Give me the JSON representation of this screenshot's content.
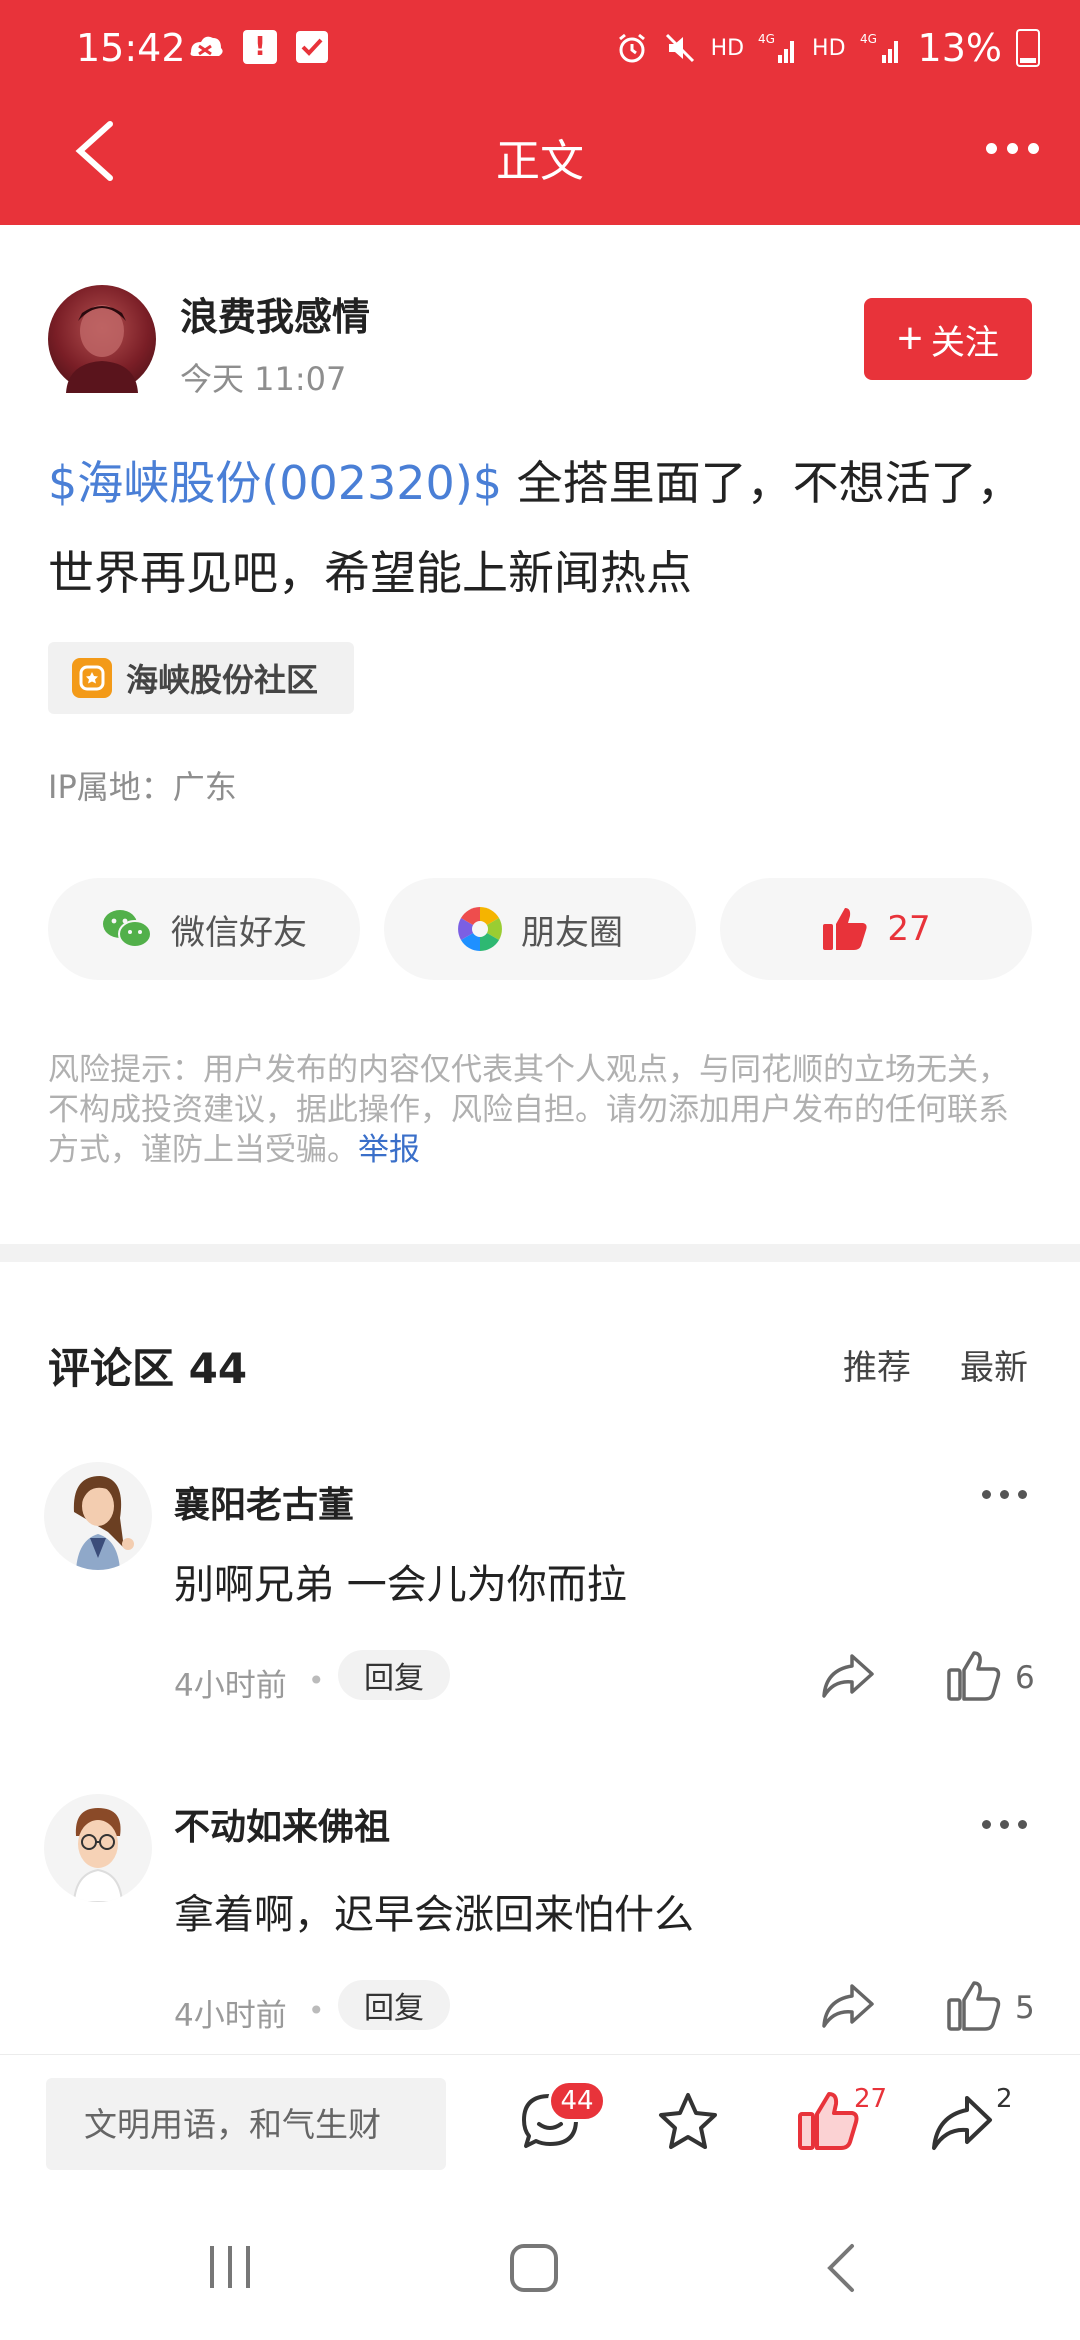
{
  "status_bar": {
    "time": "15:42",
    "right_labels": [
      "HD",
      "4G",
      "HD",
      "4G"
    ],
    "battery": "13%"
  },
  "header": {
    "title": "正文"
  },
  "post": {
    "author": "浪费我感情",
    "time": "今天 11:07",
    "follow_label": "关注",
    "stock_tag": "$海峡股份(002320)$",
    "content": " 全搭里面了，不想活了，世界再见吧，希望能上新闻热点",
    "community": "海峡股份社区",
    "ip_location": "IP属地：广东"
  },
  "share": {
    "wechat_label": "微信好友",
    "moments_label": "朋友圈",
    "like_count": "27"
  },
  "risk_notice": {
    "text": "风险提示：用户发布的内容仅代表其个人观点，与同花顺的立场无关，不构成投资建议，据此操作，风险自担。请勿添加用户发布的任何联系方式，谨防上当受骗。",
    "report_link": "举报"
  },
  "comments": {
    "title": "评论区 44",
    "sort_recommended": "推荐",
    "sort_latest": "最新",
    "items": [
      {
        "user": "襄阳老古董",
        "text": "别啊兄弟 一会儿为你而拉",
        "time": "4小时前",
        "reply_label": "回复",
        "likes": "6"
      },
      {
        "user": "不动如来佛祖",
        "text": "拿着啊，迟早会涨回来怕什么",
        "time": "4小时前",
        "reply_label": "回复",
        "likes": "5"
      }
    ]
  },
  "bottom_bar": {
    "input_placeholder": "文明用语，和气生财",
    "comment_badge": "44",
    "like_badge": "27",
    "share_badge": "2"
  },
  "colors": {
    "brand_red": "#e8333a",
    "link_blue": "#4a7fd6",
    "community_orange": "#f39a18"
  },
  "icons": [
    "back-arrow-icon",
    "more-icon",
    "wechat-icon",
    "moments-icon",
    "thumb-up-icon",
    "share-icon",
    "comment-icon",
    "star-icon",
    "recent-apps-icon",
    "home-icon",
    "nav-back-icon"
  ]
}
